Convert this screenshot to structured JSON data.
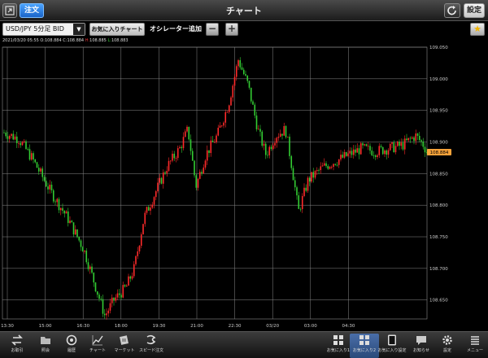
{
  "header": {
    "title": "チャート",
    "order_label": "注文",
    "settings_label": "設定"
  },
  "toolbar": {
    "pair": "USD/JPY 5分足 BID",
    "fav_chart_label": "お気に入りチャート",
    "oscillator_label": "オシレーター追加",
    "minus": "−",
    "plus": "+"
  },
  "ohlc": {
    "datetime": "2021/03/20 05:55",
    "o_label": "O:",
    "o": "108.884",
    "c_label": "C:",
    "c": "108.884",
    "h_label": "H:",
    "h": "108.885",
    "l_label": "L:",
    "l": "108.883"
  },
  "chart_data": {
    "type": "candlestick",
    "y_ticks": [
      "109.050",
      "109.000",
      "108.950",
      "108.900",
      "108.850",
      "108.800",
      "108.750",
      "108.700",
      "108.650"
    ],
    "ylim": [
      108.62,
      109.05
    ],
    "x_ticks": [
      "13:30",
      "15:00",
      "16:30",
      "18:00",
      "19:30",
      "21:00",
      "22:30",
      "03/20",
      "03:00",
      "04:30"
    ],
    "current_price": "108.884",
    "colors": {
      "up": "#ff2a2a",
      "down": "#33cc33",
      "grid": "#8a8a8a",
      "price_tag": "#f7a23a"
    }
  },
  "bottom_nav": [
    {
      "label": "お取引",
      "icon": "transfer-icon"
    },
    {
      "label": "照会",
      "icon": "folder-icon"
    },
    {
      "label": "履歴",
      "icon": "history-icon"
    },
    {
      "label": "チャート",
      "icon": "chart-icon"
    },
    {
      "label": "マーケット",
      "icon": "market-icon"
    },
    {
      "label": "スピード注文",
      "icon": "speed-order-icon"
    },
    {
      "label": "お気に入り1",
      "icon": "grid-icon"
    },
    {
      "label": "お気に入り2",
      "icon": "grid-icon"
    },
    {
      "label": "お気に入り設定",
      "icon": "tablet-icon"
    },
    {
      "label": "お知らせ",
      "icon": "message-icon"
    },
    {
      "label": "設定",
      "icon": "gear-icon"
    },
    {
      "label": "メニュー",
      "icon": "menu-icon"
    }
  ]
}
